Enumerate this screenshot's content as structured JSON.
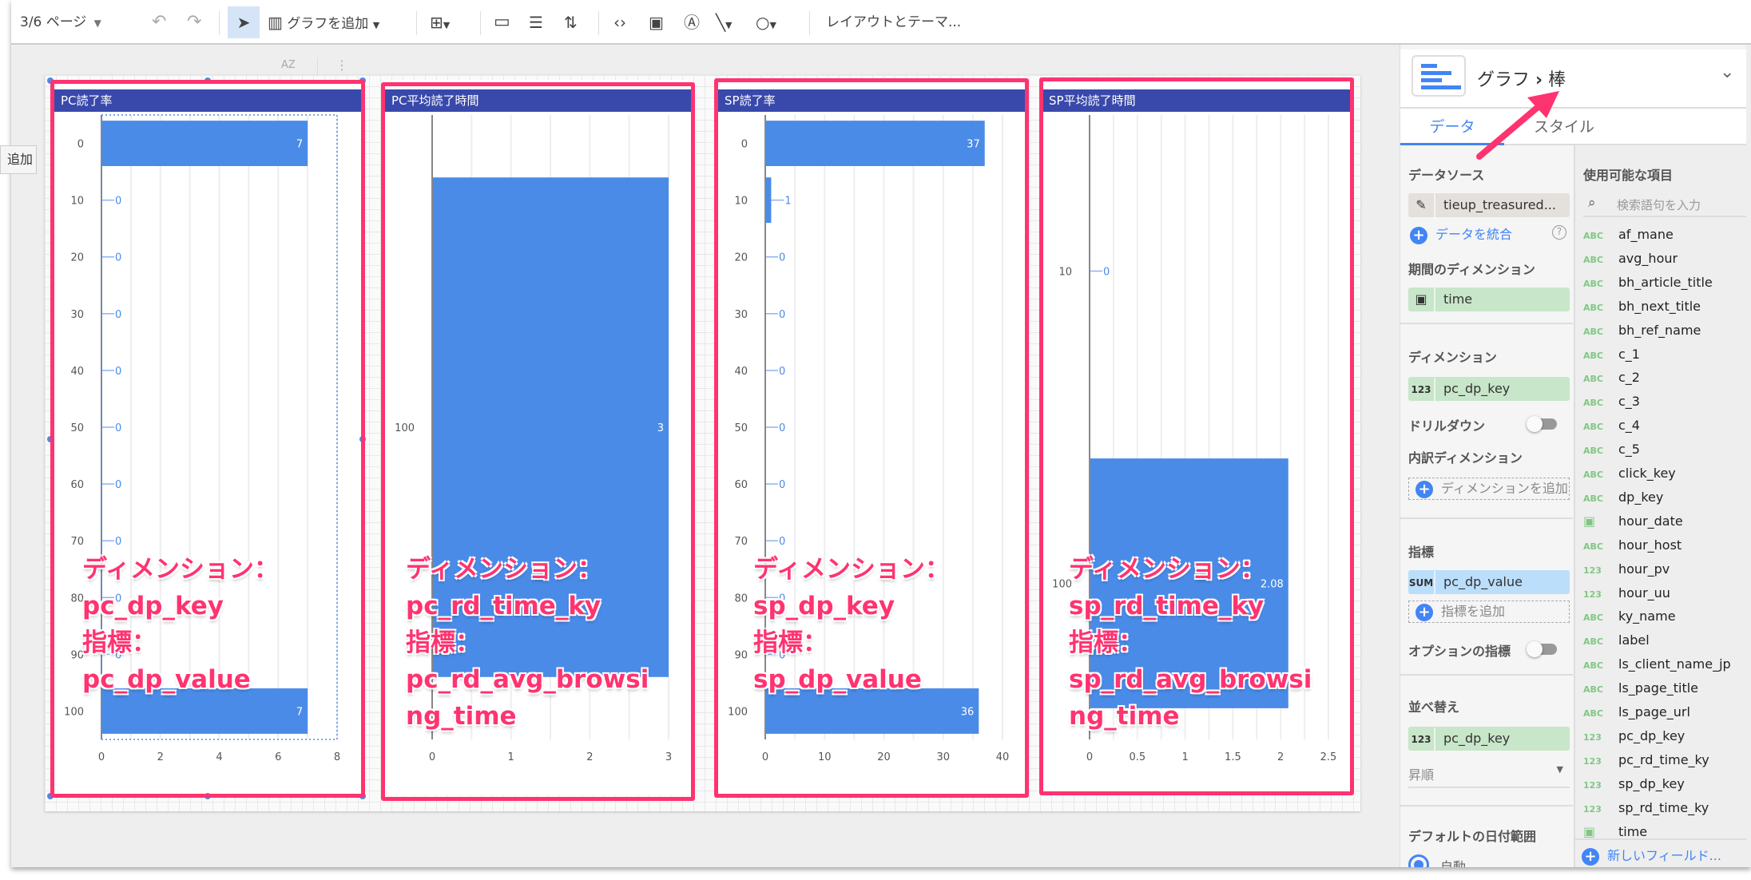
{
  "toolbar": {
    "page": "3/6 ページ",
    "add_chart": "グラフを追加",
    "layout_theme": "レイアウトとテーマ...",
    "icons": [
      "undo-icon",
      "redo-icon",
      "select-icon",
      "add-chart-icon",
      "components-icon",
      "calendar-icon",
      "filter-icon",
      "data-control-icon",
      "code-icon",
      "image-icon",
      "text-icon",
      "line-icon",
      "shape-icon"
    ]
  },
  "tooltip": "追加",
  "canvas_toolbar": {
    "sort_icon": "AZ",
    "more_icon": "⋮"
  },
  "chart_data": [
    {
      "type": "bar",
      "orientation": "horizontal",
      "title": "PC読了率",
      "categories": [
        "0",
        "10",
        "20",
        "30",
        "40",
        "50",
        "60",
        "70",
        "80",
        "90",
        "100"
      ],
      "values": [
        7,
        0,
        0,
        0,
        0,
        0,
        0,
        0,
        0,
        0,
        7
      ],
      "xlim": [
        0,
        8
      ],
      "xticks": [
        "0",
        "2",
        "4",
        "6",
        "8"
      ],
      "grid": true,
      "color": "#4a8be8"
    },
    {
      "type": "bar",
      "orientation": "horizontal",
      "title": "PC平均読了時間",
      "categories": [
        "100"
      ],
      "values": [
        3
      ],
      "xlim": [
        0,
        3
      ],
      "xticks": [
        "0",
        "1",
        "2",
        "3"
      ],
      "grid": true,
      "color": "#4a8be8"
    },
    {
      "type": "bar",
      "orientation": "horizontal",
      "title": "SP読了率",
      "categories": [
        "0",
        "10",
        "20",
        "30",
        "40",
        "50",
        "60",
        "70",
        "80",
        "90",
        "100"
      ],
      "values": [
        37,
        1,
        0,
        0,
        0,
        0,
        0,
        0,
        0,
        0,
        36
      ],
      "xlim": [
        0,
        40
      ],
      "xticks": [
        "0",
        "10",
        "20",
        "30",
        "40"
      ],
      "grid": true,
      "color": "#4a8be8"
    },
    {
      "type": "bar",
      "orientation": "horizontal",
      "title": "SP平均読了時間",
      "categories": [
        "10",
        "100"
      ],
      "values": [
        0,
        2.08
      ],
      "xlim": [
        0,
        2.5
      ],
      "xticks": [
        "0",
        "0.5",
        "1",
        "1.5",
        "2",
        "2.5"
      ],
      "grid": true,
      "color": "#4a8be8"
    }
  ],
  "annotations": [
    [
      "ディメンション：",
      "pc_dp_key",
      "指標：",
      "pc_dp_value"
    ],
    [
      "ディメンション：",
      "pc_rd_time_ky",
      "指標：",
      "pc_rd_avg_browsi",
      "ng_time"
    ],
    [
      "ディメンション：",
      "sp_dp_key",
      "指標：",
      "sp_dp_value"
    ],
    [
      "ディメンション：",
      "sp_rd_time_ky",
      "指標：",
      "sp_rd_avg_browsi",
      "ng_time"
    ]
  ],
  "annotation_color": "#ff3370",
  "panel": {
    "breadcrumb_parent": "グラフ",
    "breadcrumb_sep": "›",
    "breadcrumb_current": "棒",
    "tabs": {
      "data": "データ",
      "style": "スタイル"
    },
    "data_source_label": "データソース",
    "data_source": "tieup_treasured...",
    "blend": "データを統合",
    "date_dim_label": "期間のディメンション",
    "date_dim": "time",
    "dimension_label": "ディメンション",
    "dimension": "pc_dp_key",
    "dimension_type": "123",
    "drilldown": "ドリルダウン",
    "breakdown_label": "内訳ディメンション",
    "add_dimension": "ディメンションを追加",
    "metric_label": "指標",
    "metric_agg": "SUM",
    "metric": "pc_dp_value",
    "add_metric": "指標を追加",
    "optional_metrics": "オプションの指標",
    "sort_label": "並べ替え",
    "sort_type": "123",
    "sort_field": "pc_dp_key",
    "sort_order": "昇順",
    "default_date_label": "デフォルトの日付範囲",
    "auto": "自動",
    "available_label": "使用可能な項目",
    "search_placeholder": "検索語句を入力",
    "fields": [
      {
        "type": "ABC",
        "name": "af_mane"
      },
      {
        "type": "ABC",
        "name": "avg_hour"
      },
      {
        "type": "ABC",
        "name": "bh_article_title"
      },
      {
        "type": "ABC",
        "name": "bh_next_title"
      },
      {
        "type": "ABC",
        "name": "bh_ref_name"
      },
      {
        "type": "ABC",
        "name": "c_1"
      },
      {
        "type": "ABC",
        "name": "c_2"
      },
      {
        "type": "ABC",
        "name": "c_3"
      },
      {
        "type": "ABC",
        "name": "c_4"
      },
      {
        "type": "ABC",
        "name": "c_5"
      },
      {
        "type": "ABC",
        "name": "click_key"
      },
      {
        "type": "ABC",
        "name": "dp_key"
      },
      {
        "type": "DATE",
        "name": "hour_date"
      },
      {
        "type": "ABC",
        "name": "hour_host"
      },
      {
        "type": "123",
        "name": "hour_pv"
      },
      {
        "type": "123",
        "name": "hour_uu"
      },
      {
        "type": "ABC",
        "name": "ky_name"
      },
      {
        "type": "ABC",
        "name": "label"
      },
      {
        "type": "ABC",
        "name": "ls_client_name_jp"
      },
      {
        "type": "ABC",
        "name": "ls_page_title"
      },
      {
        "type": "ABC",
        "name": "ls_page_url"
      },
      {
        "type": "123",
        "name": "pc_dp_key"
      },
      {
        "type": "123",
        "name": "pc_rd_time_ky"
      },
      {
        "type": "123",
        "name": "sp_dp_key"
      },
      {
        "type": "123",
        "name": "sp_rd_time_ky"
      },
      {
        "type": "DATE",
        "name": "time"
      }
    ],
    "new_field": "新しいフィールド..."
  }
}
